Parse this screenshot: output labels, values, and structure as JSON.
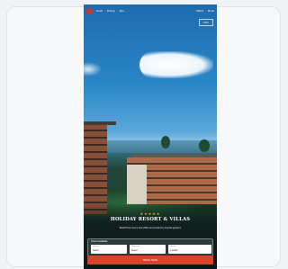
{
  "nav": {
    "items": [
      "Hotel",
      "Dining",
      "Spa"
    ],
    "right": [
      "Offers",
      "Book"
    ]
  },
  "badge": "STAY",
  "hero": {
    "stars": "★★★★★",
    "headline": "HOLIDAY RESORT & VILLAS",
    "subtitle": "Beachfront rooms and villas surrounded by tropical gardens"
  },
  "booking": {
    "title": "Check availability",
    "checkin": {
      "label": "Check-in",
      "value": "Select"
    },
    "checkout": {
      "label": "Check-out",
      "value": "Select"
    },
    "guests": {
      "label": "Guests",
      "value": "2 Adults"
    },
    "cta": "BOOK NOW"
  }
}
